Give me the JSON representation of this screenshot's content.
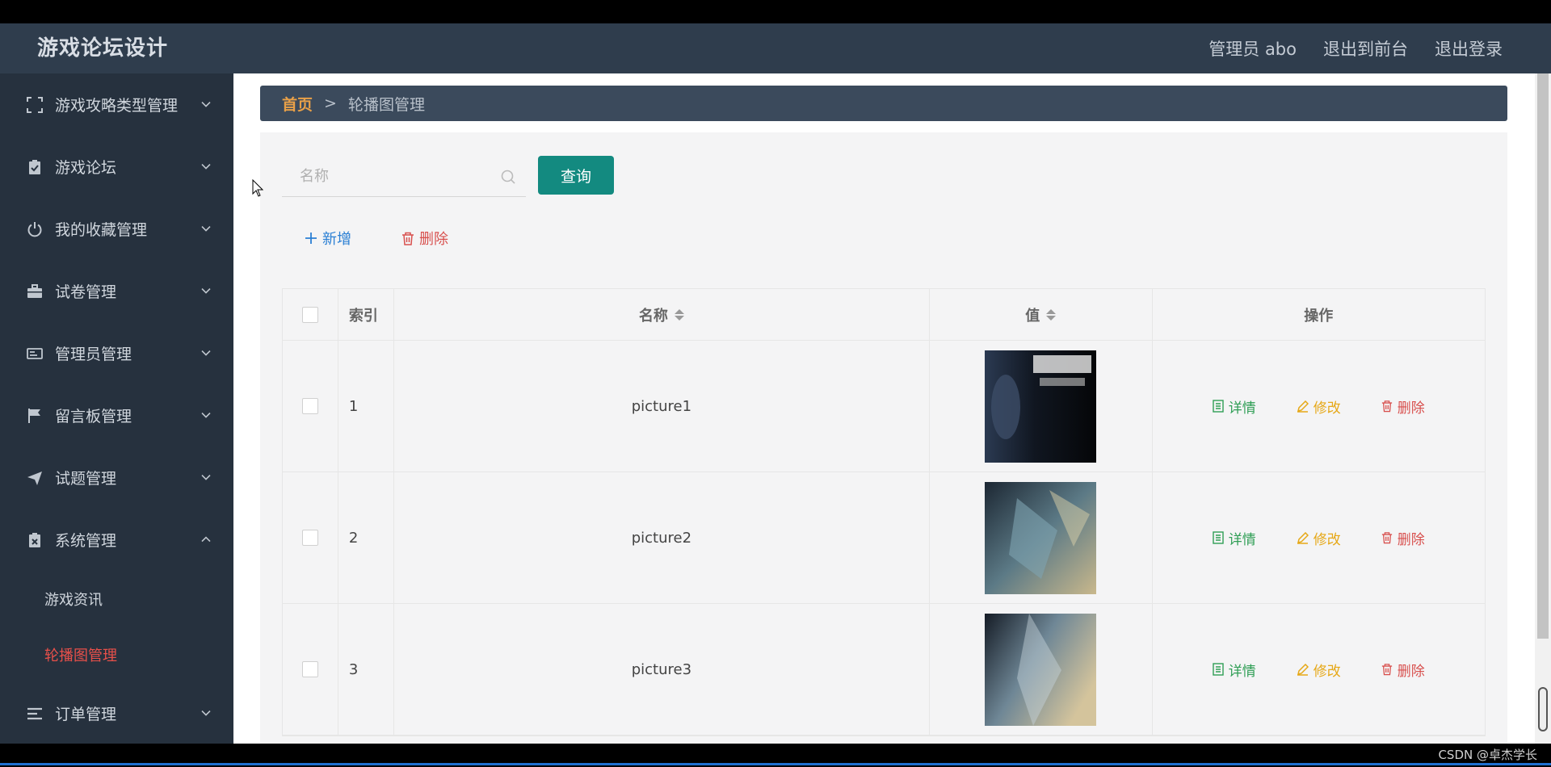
{
  "header": {
    "title": "游戏论坛设计",
    "user_label": "管理员 abo",
    "to_front_label": "退出到前台",
    "logout_label": "退出登录"
  },
  "sidebar": {
    "items": [
      {
        "label": "游戏攻略类型管理",
        "icon": "expand-icon"
      },
      {
        "label": "游戏论坛",
        "icon": "clipboard-check-icon"
      },
      {
        "label": "我的收藏管理",
        "icon": "power-icon"
      },
      {
        "label": "试卷管理",
        "icon": "briefcase-icon"
      },
      {
        "label": "管理员管理",
        "icon": "id-card-icon"
      },
      {
        "label": "留言板管理",
        "icon": "flag-icon"
      },
      {
        "label": "试题管理",
        "icon": "send-icon"
      },
      {
        "label": "系统管理",
        "icon": "clipboard-x-icon",
        "expanded": true
      },
      {
        "label": "订单管理",
        "icon": "list-icon"
      }
    ],
    "submenu": [
      {
        "label": "游戏资讯",
        "active": false
      },
      {
        "label": "轮播图管理",
        "active": true
      }
    ]
  },
  "breadcrumb": {
    "home": "首页",
    "separator": ">",
    "current": "轮播图管理"
  },
  "search": {
    "placeholder": "名称",
    "value": "",
    "button_label": "查询"
  },
  "actions": {
    "add_label": "新增",
    "delete_label": "删除"
  },
  "table": {
    "headers": {
      "index": "索引",
      "name": "名称",
      "value": "值",
      "operation": "操作"
    },
    "rows": [
      {
        "index": "1",
        "name": "picture1"
      },
      {
        "index": "2",
        "name": "picture2"
      },
      {
        "index": "3",
        "name": "picture3"
      }
    ],
    "row_actions": {
      "detail": "详情",
      "edit": "修改",
      "remove": "删除"
    }
  },
  "watermark": "CSDN @卓杰学长",
  "colors": {
    "header_bg": "#2f3d4d",
    "sidebar_bg": "#26313e",
    "active_menu": "#e8504a",
    "query_button": "#138a80",
    "detail": "#2f9e55",
    "edit": "#e6a817",
    "remove": "#d8504e"
  }
}
